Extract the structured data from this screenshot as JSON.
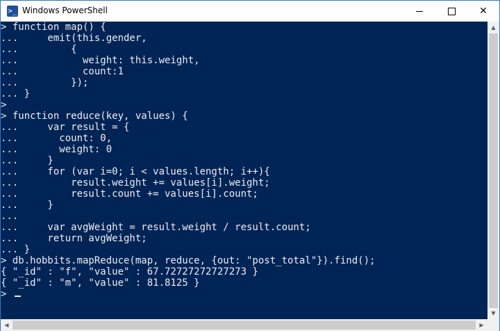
{
  "window": {
    "title": "Windows PowerShell",
    "app_icon_glyph": ">_",
    "minimize_icon": "minimize-icon",
    "maximize_icon": "maximize-icon",
    "close_glyph": "✕"
  },
  "console": {
    "background": "#012456",
    "foreground": "#eeedf0",
    "lines": [
      "> function map() {",
      "...     emit(this.gender,",
      "...         {",
      "...           weight: this.weight,",
      "...           count:1",
      "...         });",
      "... }",
      ">",
      "> function reduce(key, values) {",
      "...     var result = {",
      "...       count: 0,",
      "...       weight: 0",
      "...     }",
      "...     for (var i=0; i < values.length; i++){",
      "...         result.weight += values[i].weight;",
      "...         result.count += values[i].count;",
      "...     }",
      "...",
      "...     var avgWeight = result.weight / result.count;",
      "...     return avgWeight;",
      "... }",
      "> db.hobbits.mapReduce(map, reduce, {out: \"post_total\"}).find();",
      "{ \"_id\" : \"f\", \"value\" : 67.72727272727273 }",
      "{ \"_id\" : \"m\", \"value\" : 81.8125 }",
      ">"
    ]
  },
  "scrollbars": {
    "up_arrow": "▲",
    "down_arrow": "▼",
    "left_arrow": "◀",
    "right_arrow": "▶"
  }
}
